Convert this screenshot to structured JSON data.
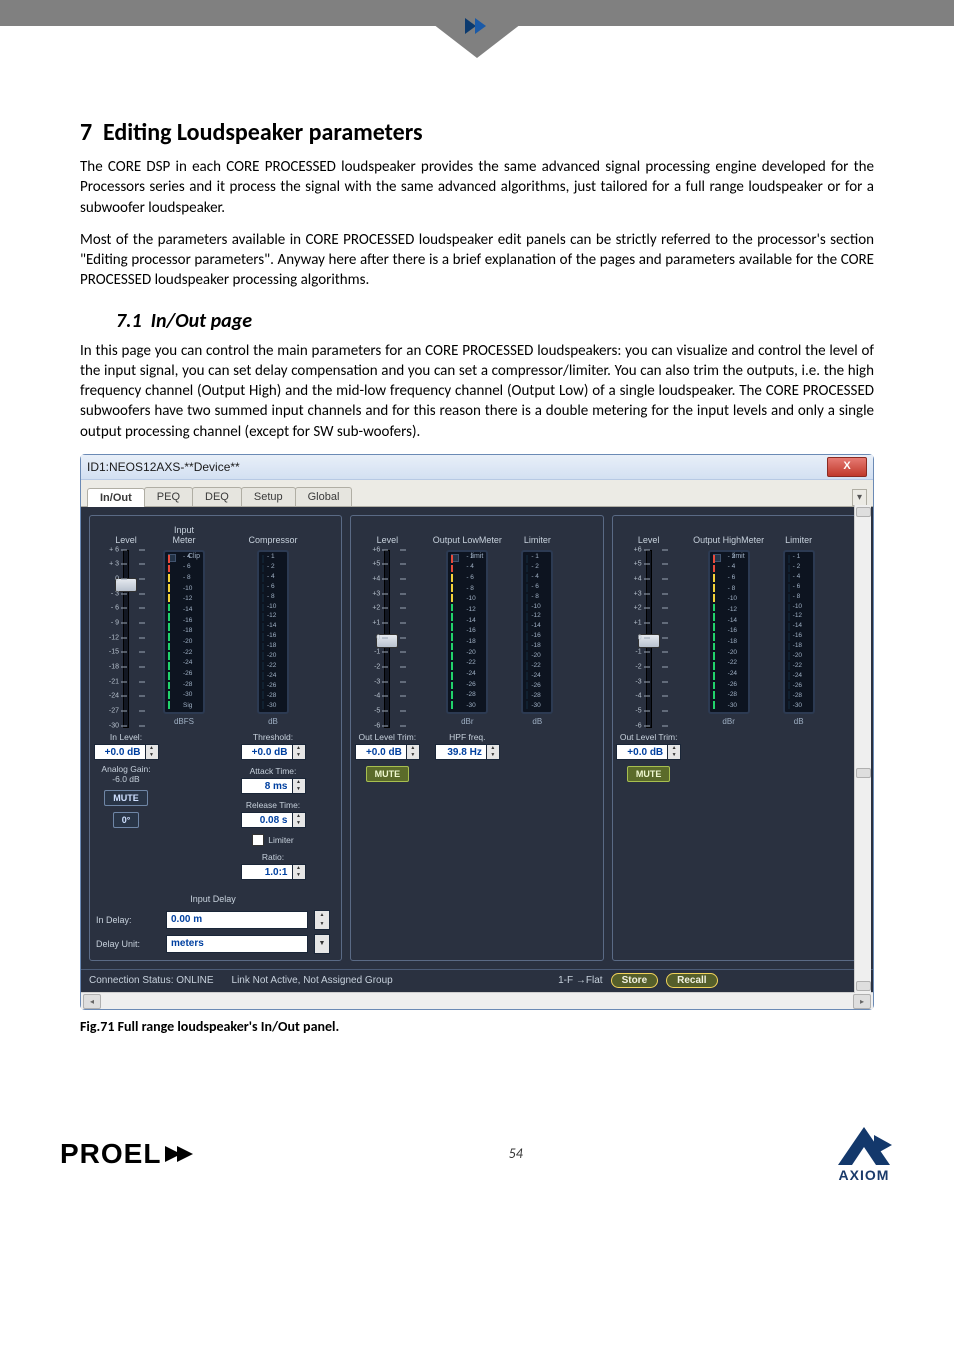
{
  "section": {
    "number": "7",
    "title": "Editing Loudspeaker parameters"
  },
  "para1": "The CORE DSP in each CORE PROCESSED loudspeaker provides the same advanced signal processing engine developed for the Processors series and it process the signal with the same advanced algorithms, just tailored for a full range loudspeaker or for a subwoofer loudspeaker.",
  "para2": "Most of the parameters available in CORE PROCESSED loudspeaker edit panels can be strictly referred to the processor's section \"Editing processor parameters\". Anyway here after there is a brief explanation of the pages and parameters available for the CORE PROCESSED loudspeaker processing algorithms.",
  "subsection": {
    "number": "7.1",
    "title": "In/Out page"
  },
  "para3": "In this page you can control the main parameters for an CORE PROCESSED loudspeakers: you can visualize and control the level of the input signal, you can set delay compensation and you can set a compressor/limiter. You can also trim the outputs, i.e. the high frequency channel (Output High) and the mid-low frequency channel (Output Low) of a single loudspeaker. The CORE PROCESSED subwoofers have two summed input channels and for this reason there is a double metering for the input levels and only a single output processing channel (except for SW sub-woofers).",
  "dialog": {
    "title": "ID1:NEOS12AXS-**Device**",
    "close": "X",
    "tabs": [
      "In/Out",
      "PEQ",
      "DEQ",
      "Setup",
      "Global"
    ],
    "active_tab": 0,
    "col_labels": {
      "level": "Level",
      "input_meter": "Input\nMeter",
      "compressor": "Compressor",
      "meter": "Meter",
      "limiter": "Limiter",
      "output_low": "Output Low",
      "output_high": "Output High"
    },
    "input": {
      "slider_ticks": [
        "+ 6",
        "+ 3",
        "0",
        "- 3",
        "- 6",
        "- 9",
        "-12",
        "-15",
        "-18",
        "-21",
        "-24",
        "-27",
        "-30"
      ],
      "in_level_label": "In Level:",
      "in_level_value": "+0.0 dB",
      "analog_gain_label": "Analog Gain:",
      "analog_gain_value": "-6.0 dB",
      "mute_label": "MUTE",
      "phase_label": "0°",
      "meter_top": "Clip",
      "meter_scale": [
        "- 4",
        "- 6",
        "- 8",
        "-10",
        "-12",
        "-14",
        "-16",
        "-18",
        "-20",
        "-22",
        "-24",
        "-26",
        "-28",
        "-30",
        "Sig"
      ],
      "meter_unit": "dBFS",
      "comp_scale": [
        "- 1",
        "- 2",
        "- 4",
        "- 6",
        "- 8",
        "-10",
        "-12",
        "-14",
        "-16",
        "-18",
        "-20",
        "-22",
        "-24",
        "-26",
        "-28",
        "-30"
      ],
      "comp_unit": "dB",
      "threshold_label": "Threshold:",
      "threshold_value": "+0.0 dB",
      "attack_label": "Attack Time:",
      "attack_value": "8 ms",
      "release_label": "Release Time:",
      "release_value": "0.08 s",
      "limiter_label": "Limiter",
      "ratio_label": "Ratio:",
      "ratio_value": "1.0:1",
      "delay_section_label": "Input Delay",
      "in_delay_label": "In Delay:",
      "in_delay_value": "0.00 m",
      "delay_unit_label": "Delay Unit:",
      "delay_unit_value": "meters"
    },
    "output": {
      "slider_ticks": [
        "+6",
        "+5",
        "+4",
        "+3",
        "+2",
        "+1",
        "0",
        "-1",
        "-2",
        "-3",
        "-4",
        "-5",
        "-6"
      ],
      "trim_label": "Out Level Trim:",
      "trim_value": "+0.0 dB",
      "mute_label": "MUTE",
      "meter_top": "limit",
      "meter_scale": [
        "- 2",
        "- 4",
        "- 6",
        "- 8",
        "-10",
        "-12",
        "-14",
        "-16",
        "-18",
        "-20",
        "-22",
        "-24",
        "-26",
        "-28",
        "-30"
      ],
      "meter_unit": "dBr",
      "lim_scale": [
        "- 1",
        "- 2",
        "- 4",
        "- 6",
        "- 8",
        "-10",
        "-12",
        "-14",
        "-16",
        "-18",
        "-20",
        "-22",
        "-24",
        "-26",
        "-28",
        "-30"
      ],
      "lim_unit": "dB",
      "hpf_label": "HPF freq.",
      "hpf_value": "39.8 Hz"
    },
    "status": {
      "conn": "Connection Status: ONLINE",
      "link": "Link Not Active,  Not Assigned Group",
      "preset": "1-F →Flat",
      "store": "Store",
      "recall": "Recall"
    }
  },
  "caption": "Fig.71 Full range loudspeaker's In/Out panel.",
  "page_number": "54",
  "logos": {
    "proel": "PROEL",
    "axiom": "AXIOM"
  }
}
